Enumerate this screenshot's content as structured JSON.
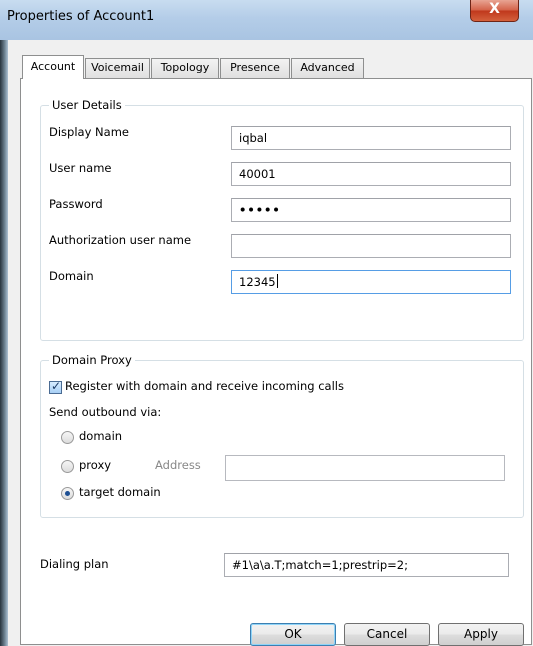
{
  "window": {
    "title": "Properties of Account1",
    "close_glyph": "X"
  },
  "tabs": [
    {
      "label": "Account",
      "active": true
    },
    {
      "label": "Voicemail",
      "active": false
    },
    {
      "label": "Topology",
      "active": false
    },
    {
      "label": "Presence",
      "active": false
    },
    {
      "label": "Advanced",
      "active": false
    }
  ],
  "user_details": {
    "legend": "User Details",
    "display_name": {
      "label": "Display Name",
      "value": "iqbal"
    },
    "user_name": {
      "label": "User name",
      "value": "40001"
    },
    "password": {
      "label": "Password",
      "value": "•••••"
    },
    "auth_user_name": {
      "label": "Authorization user name",
      "value": ""
    },
    "domain": {
      "label": "Domain",
      "value": "12345"
    }
  },
  "domain_proxy": {
    "legend": "Domain Proxy",
    "register_label": "Register with domain and receive incoming calls",
    "register_checked": true,
    "send_outbound_label": "Send outbound via:",
    "options": [
      {
        "label": "domain",
        "selected": false
      },
      {
        "label": "proxy",
        "selected": false
      },
      {
        "label": "target domain",
        "selected": true
      }
    ],
    "address_label": "Address",
    "address_value": ""
  },
  "dialing_plan": {
    "label": "Dialing plan",
    "value": "#1\\a\\a.T;match=1;prestrip=2;"
  },
  "buttons": {
    "ok": "OK",
    "cancel": "Cancel",
    "apply": "Apply"
  }
}
